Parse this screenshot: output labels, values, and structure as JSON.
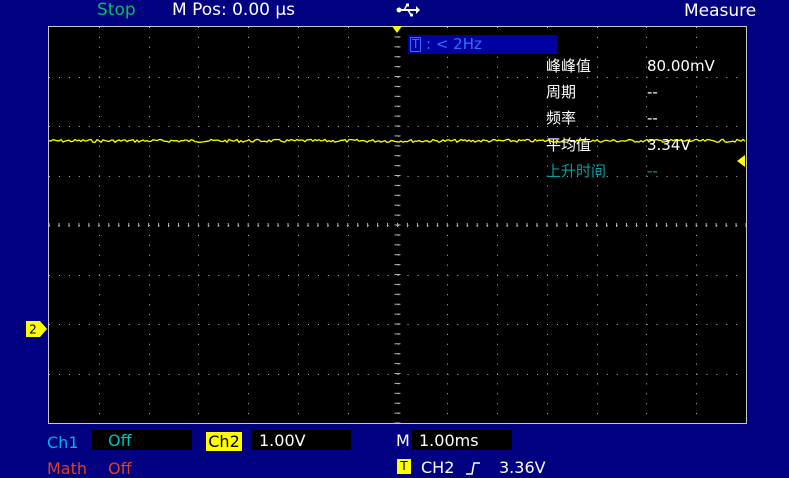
{
  "header": {
    "status": "Stop",
    "mpos": "M Pos: 0.00 µs",
    "usb_icon": "usb-icon",
    "menu_title": "Measure"
  },
  "freq_indicator": {
    "t_label": "T",
    "text": ": < 2Hz"
  },
  "measurements": [
    {
      "label": "峰峰值",
      "value": "80.00mV",
      "active": true
    },
    {
      "label": "周期",
      "value": "--",
      "active": true
    },
    {
      "label": "频率",
      "value": "--",
      "active": true
    },
    {
      "label": "平均值",
      "value": "3.34V",
      "active": true
    },
    {
      "label": "上升时间",
      "value": "--",
      "active": false
    }
  ],
  "markers": {
    "ch2_ground": "2"
  },
  "waveform": {
    "channel": "CH2",
    "color": "#ffff00",
    "level_div": 5.7
  },
  "bottom": {
    "ch1_label": "Ch1",
    "ch1_value": "Off",
    "ch2_label": "Ch2",
    "ch2_value": "1.00V",
    "m_label": "M",
    "m_value": "1.00ms",
    "math_label": "Math",
    "math_value": "Off",
    "trig_badge": "T",
    "trig_source": "CH2",
    "trig_slope_icon": "rising-edge-icon",
    "trig_level": "3.36V"
  },
  "colors": {
    "background": "#000080",
    "grid_bg": "#000000",
    "trace": "#ffff00",
    "ch1": "#00b0f0",
    "math": "#e04020",
    "status": "#00c060"
  }
}
